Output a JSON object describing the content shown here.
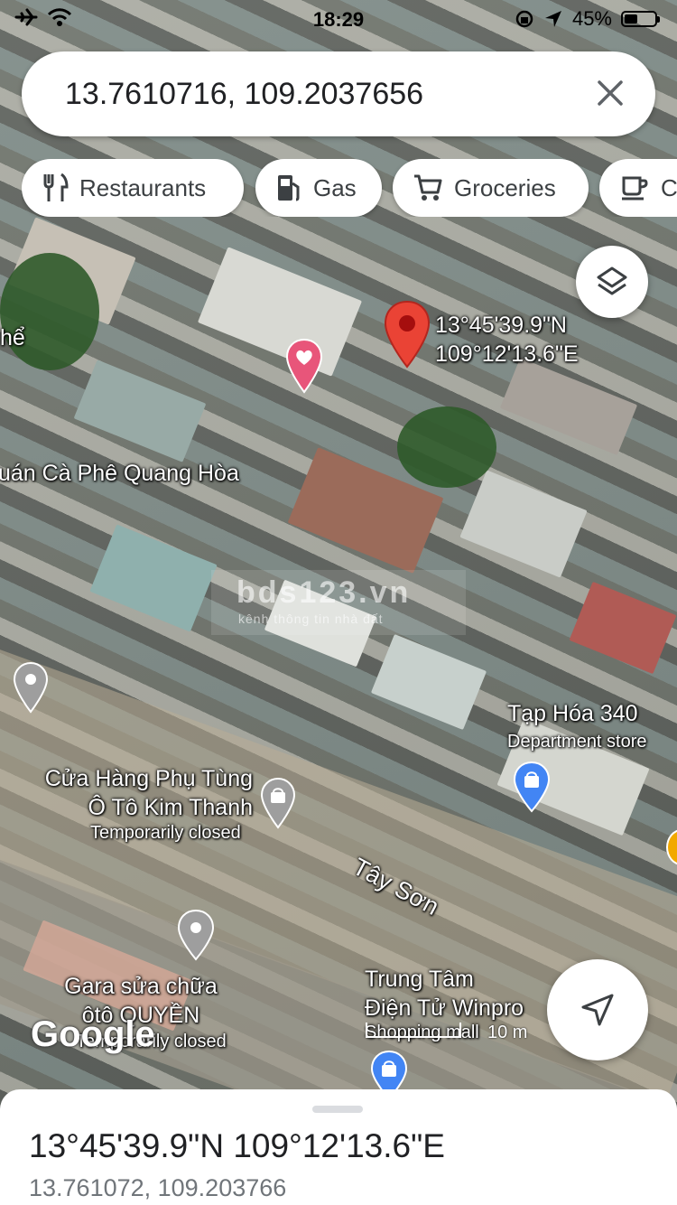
{
  "status_bar": {
    "time": "18:29",
    "battery_pct": "45%"
  },
  "search": {
    "query": "13.7610716, 109.2037656",
    "clear_icon": "close-icon"
  },
  "chips": [
    {
      "label": "Restaurants",
      "icon": "restaurant-icon"
    },
    {
      "label": "Gas",
      "icon": "gas-station-icon"
    },
    {
      "label": "Groceries",
      "icon": "cart-icon"
    },
    {
      "label": "Co",
      "icon": "coffee-icon"
    }
  ],
  "map": {
    "pin": {
      "lat_label": "13°45'39.9\"N",
      "lng_label": "109°12'13.6\"E"
    },
    "labels": {
      "the": "hể",
      "cafe": "uán Cà Phê Quang Hòa",
      "taphoa_name": "Tạp Hóa 340",
      "taphoa_type": "Department store",
      "cuahang_1": "Cửa Hàng Phụ Tùng",
      "cuahang_2": "Ô Tô Kim Thanh",
      "cuahang_status": "Temporarily closed",
      "street": "Tây Sơn",
      "gara_1": "Gara sửa chữa",
      "gara_2": "ôtô QUYỀN",
      "gara_status": "Temporarily closed",
      "trungtam_1": "Trung Tâm",
      "trungtam_2": "Điện Tử Winpro",
      "trungtam_type": "Shopping mall"
    },
    "watermark_main": "bds123.vn",
    "watermark_sub": "kênh thông tin nhà đất",
    "google_logo": "Google",
    "scale_label": "10 m"
  },
  "bottom_sheet": {
    "dms": "13°45'39.9\"N 109°12'13.6\"E",
    "decimal": "13.761072, 109.203766"
  },
  "colors": {
    "pin_red": "#ea4335",
    "shopping_blue": "#4285f4",
    "favorite_pink": "#e8557a",
    "poi_gray": "#9e9e9e"
  }
}
